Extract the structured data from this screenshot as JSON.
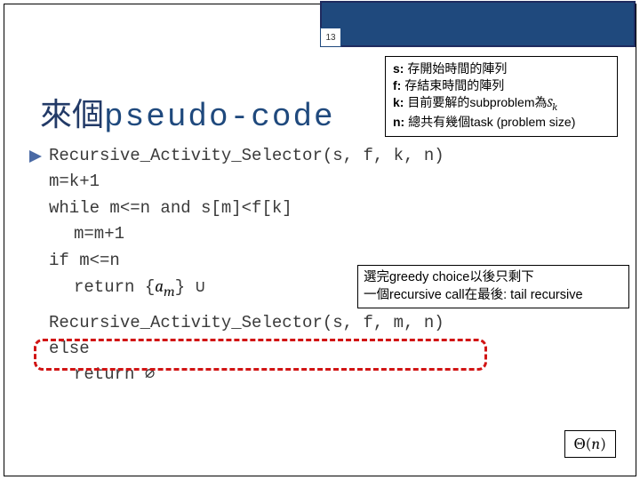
{
  "page_number": "13",
  "title": {
    "cjk": "來個",
    "latin": "pseudo-code"
  },
  "legend": [
    {
      "key": "s:",
      "desc": "存開始時間的陣列"
    },
    {
      "key": "f:",
      "desc": "存結束時間的陣列"
    },
    {
      "key": "k:",
      "desc_pre": "目前要解的subproblem為",
      "math": "S",
      "sub": "k"
    },
    {
      "key": "n:",
      "desc": "總共有幾個task (problem size)"
    }
  ],
  "code": {
    "l0": "Recursive_Activity_Selector(s, f, k, n)",
    "l1": "m=k+1",
    "l2": "while m<=n and s[m]<f[k]",
    "l3": "m=m+1",
    "l4": "if m<=n",
    "l5_pre": "return {",
    "l5_math": "a",
    "l5_sub": "m",
    "l5_post": "} ∪",
    "l6": "Recursive_Activity_Selector(s, f, m, n)",
    "l7": "else",
    "l8": "return ∅"
  },
  "note": {
    "line1": "選完greedy choice以後只剩下",
    "line2": "一個recursive call在最後: tail recursive"
  },
  "complexity": {
    "theta": "Θ(",
    "var": "n",
    "close": ")"
  }
}
